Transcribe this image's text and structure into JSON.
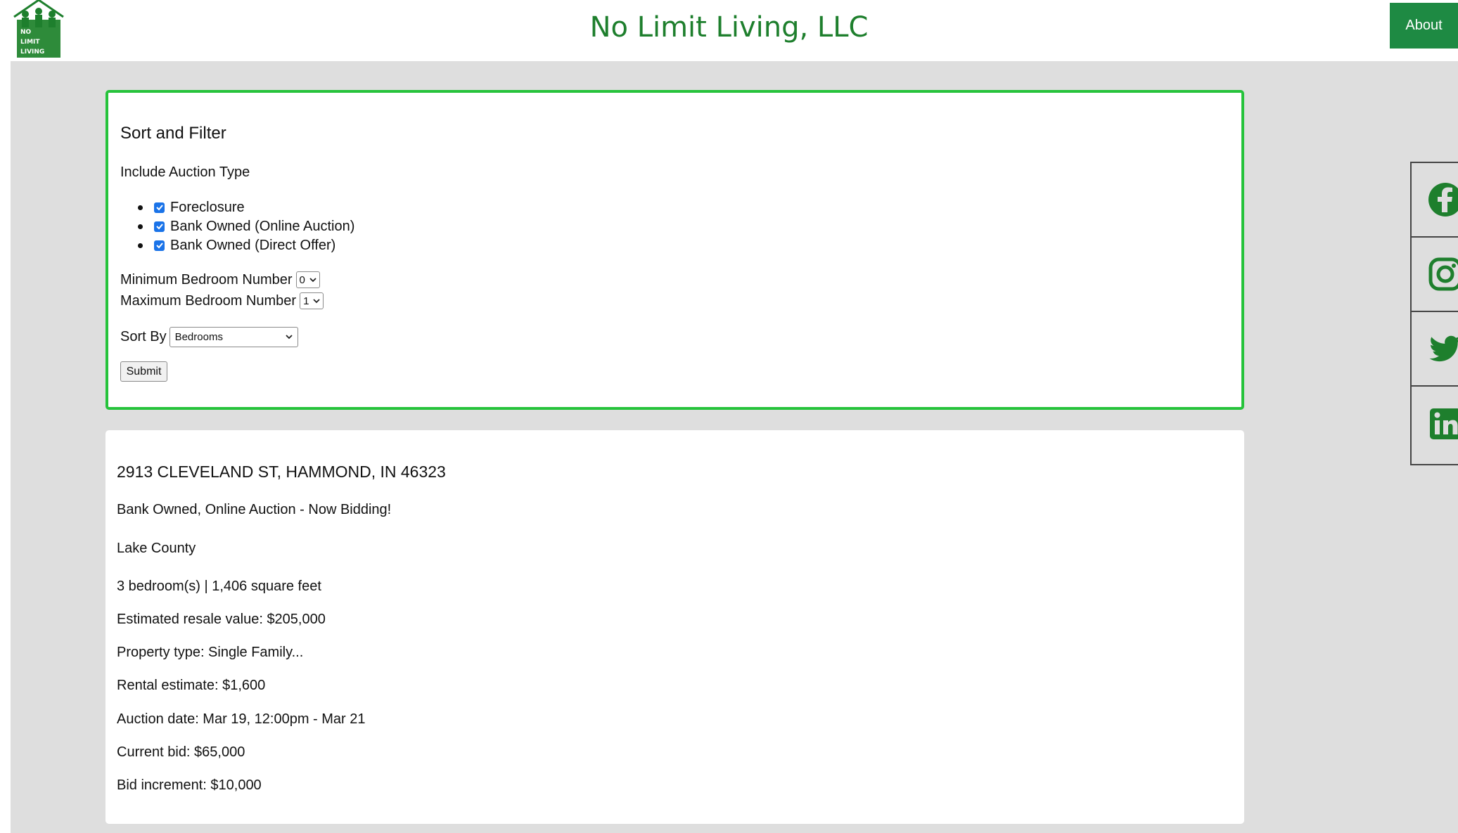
{
  "header": {
    "logo_text": [
      "NO",
      "LIMIT",
      "LIVING"
    ],
    "title": "No Limit Living, LLC",
    "about_label": "About"
  },
  "colors": {
    "brand_green": "#1e7f2d",
    "button_green": "#1e8a43",
    "panel_border": "#26c33b",
    "checkbox_blue": "#1a73e8",
    "page_gray": "#dedede"
  },
  "filter": {
    "title": "Sort and Filter",
    "auction_label": "Include Auction Type",
    "auction_types": [
      {
        "label": "Foreclosure",
        "checked": true
      },
      {
        "label": "Bank Owned (Online Auction)",
        "checked": true
      },
      {
        "label": "Bank Owned (Direct Offer)",
        "checked": true
      }
    ],
    "min_bed_label": "Minimum Bedroom Number",
    "min_bed_value": "0",
    "max_bed_label": "Maximum Bedroom Number",
    "max_bed_value": "1",
    "sort_label": "Sort By",
    "sort_value": "Bedrooms",
    "submit_label": "Submit"
  },
  "listing": {
    "address": "2913 CLEVELAND ST, HAMMOND, IN 46323",
    "status": "Bank Owned, Online Auction - Now Bidding!",
    "county": "Lake County",
    "size": "3 bedroom(s) | 1,406 square feet",
    "resale": "Estimated resale value: $205,000",
    "property_type": "Property type: Single Family...",
    "rental": "Rental estimate: $1,600",
    "auction_date": "Auction date: Mar 19, 12:00pm - Mar 21",
    "current_bid": "Current bid: $65,000",
    "bid_increment": "Bid increment: $10,000"
  },
  "social": {
    "icons": [
      "facebook-icon",
      "instagram-icon",
      "twitter-icon",
      "linkedin-icon"
    ]
  }
}
